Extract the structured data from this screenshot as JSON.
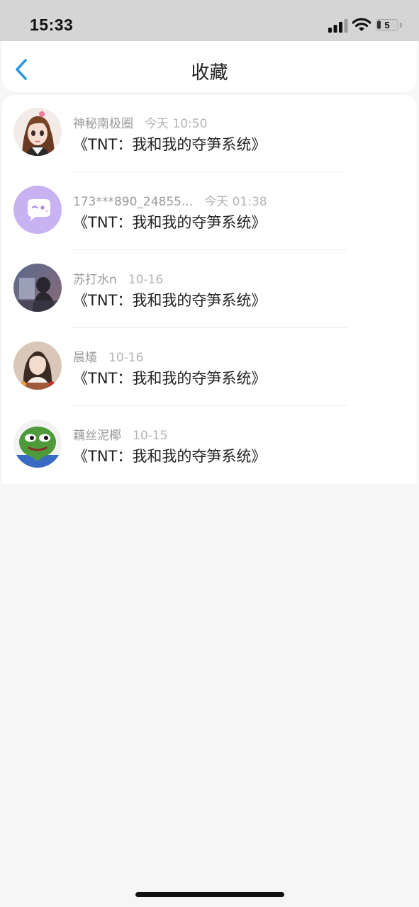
{
  "status_bar": {
    "time": "15:33",
    "battery_level": "5",
    "battery_fraction": 0.05
  },
  "nav": {
    "title": "收藏"
  },
  "favorites": [
    {
      "user": "神秘南极圈",
      "date": "今天 10:50",
      "book": "《TNT：我和我的夺笋系统》",
      "avatar_icon": "girl-doll-avatar"
    },
    {
      "user": "173***890_24855...",
      "date": "今天 01:38",
      "book": "《TNT：我和我的夺笋系统》",
      "avatar_icon": "default-chat-avatar"
    },
    {
      "user": "苏打水n",
      "date": "10-16",
      "book": "《TNT：我和我的夺笋系统》",
      "avatar_icon": "dark-photo-avatar"
    },
    {
      "user": "晨燨",
      "date": "10-16",
      "book": "《TNT：我和我的夺笋系统》",
      "avatar_icon": "girl-photo-avatar"
    },
    {
      "user": "藕丝泥椰",
      "date": "10-15",
      "book": "《TNT：我和我的夺笋系统》",
      "avatar_icon": "green-frog-avatar"
    }
  ],
  "colors": {
    "accent": "#2b9ae0",
    "background": "#f6f6f6",
    "status_bar": "#d5d5d5"
  }
}
